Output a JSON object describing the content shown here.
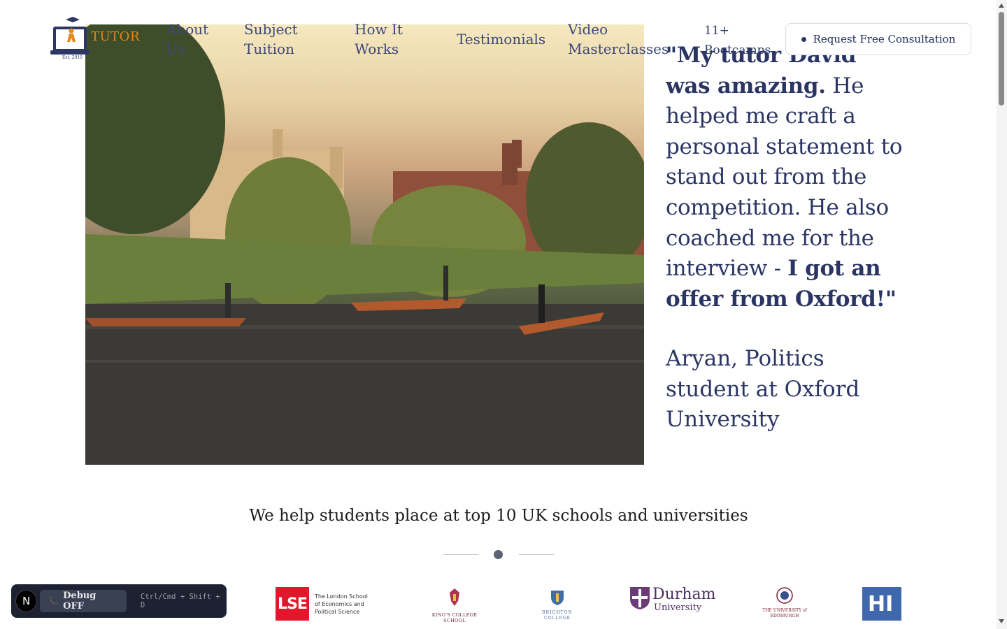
{
  "header": {
    "logo_text": "TUTOR",
    "logo_est": "Est. 2010",
    "nav": {
      "about": "About\nUs",
      "subject_tuition": "Subject\nTuition",
      "how_it_works": "How It\nWorks",
      "testimonials": "Testimonials",
      "video_masterclasses": "Video\nMasterclasses",
      "bootcamps": "11+\nBootcamps"
    },
    "cta_label": "Request Free Consultation"
  },
  "hero": {
    "quote_bold_start": "\"My tutor David was amazing.",
    "quote_regular": " He helped me craft a personal statement to stand out from the competition. He also coached me for the interview - ",
    "quote_bold_end": "I got an offer from Oxford!\"",
    "attribution": "Aryan, Politics student at Oxford University"
  },
  "section": {
    "title": "We help students place at top 10 UK schools and universities"
  },
  "logos": {
    "lse_mark": "LSE",
    "lse_name": "The London School of Economics and Political Science",
    "kcs_name": "KING'S COLLEGE SCHOOL",
    "brighton_name": "BRIGHTON COLLEGE",
    "durham_line1": "Durham",
    "durham_line2": "University",
    "edinburgh_name": "THE UNIVERSITY of EDINBURGH",
    "partial_mark": "HI"
  },
  "debug": {
    "badge": "N",
    "button_label": "Debug OFF",
    "shortcut": "Ctrl/Cmd + Shift + D"
  },
  "colors": {
    "navy": "#2a3564",
    "logo_orange": "#e08a1f",
    "lse_red": "#e2172c",
    "durham_purple": "#4b2e60"
  }
}
